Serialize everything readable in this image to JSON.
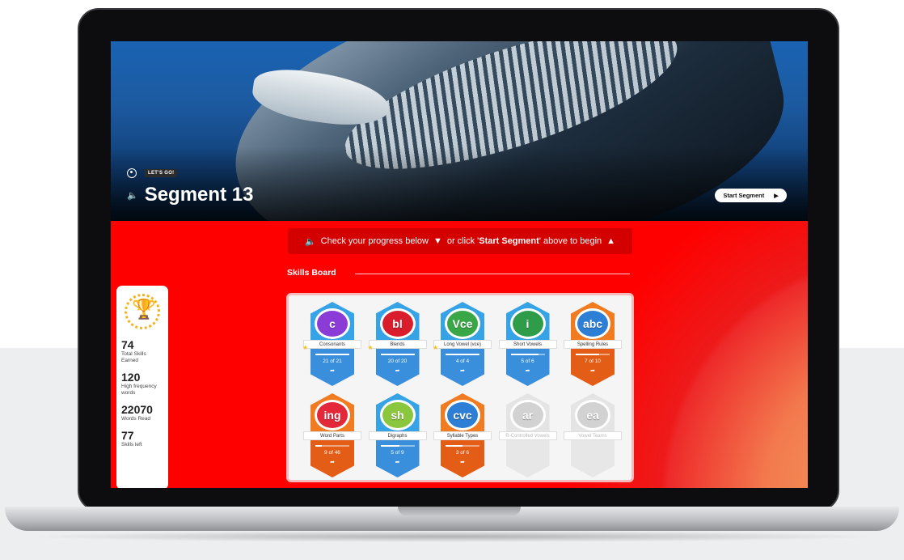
{
  "hero": {
    "tag": "LET'S GO!",
    "title": "Segment 13",
    "start_label": "Start Segment"
  },
  "banner": {
    "text_before": "Check your progress below",
    "text_middle": "or click '",
    "text_bold": "Start Segment",
    "text_after": "' above to begin"
  },
  "skills_board": {
    "heading": "Skills Board",
    "badges": [
      {
        "name": "Consonants",
        "glyph": "c",
        "progress": "21 of 21",
        "fraction": 1.0,
        "color_top": "#35a3e6",
        "color_bottom": "#3a8fdc",
        "coin": "#8b3bd6",
        "starred": true
      },
      {
        "name": "Blends",
        "glyph": "bl",
        "progress": "20 of 20",
        "fraction": 1.0,
        "color_top": "#35a3e6",
        "color_bottom": "#3a8fdc",
        "coin": "#d91d2c",
        "starred": true
      },
      {
        "name": "Long Vowel (vce)",
        "glyph": "Vce",
        "progress": "4 of 4",
        "fraction": 1.0,
        "color_top": "#35a3e6",
        "color_bottom": "#3a8fdc",
        "coin": "#3aa746",
        "starred": true
      },
      {
        "name": "Short Vowels",
        "glyph": "i",
        "progress": "5 of 6",
        "fraction": 0.83,
        "color_top": "#35a3e6",
        "color_bottom": "#3a8fdc",
        "coin": "#2f9c4a",
        "starred": false
      },
      {
        "name": "Spelling Rules",
        "glyph": "abc",
        "progress": "7 of 10",
        "fraction": 0.7,
        "color_top": "#f07b21",
        "color_bottom": "#e35d16",
        "coin": "#2d7fd6",
        "starred": false
      },
      {
        "name": "Word Parts",
        "glyph": "ing",
        "progress": "9 of 46",
        "fraction": 0.2,
        "color_top": "#f07b21",
        "color_bottom": "#e35d16",
        "coin": "#e3283a",
        "starred": false
      },
      {
        "name": "Digraphs",
        "glyph": "sh",
        "progress": "5 of 9",
        "fraction": 0.56,
        "color_top": "#35a3e6",
        "color_bottom": "#3a8fdc",
        "coin": "#8bc63f",
        "starred": false
      },
      {
        "name": "Syllable Types",
        "glyph": "cvc",
        "progress": "3 of 6",
        "fraction": 0.5,
        "color_top": "#f07b21",
        "color_bottom": "#e35d16",
        "coin": "#2d7fd6",
        "starred": false
      },
      {
        "name": "R-Controlled Vowels",
        "glyph": "ar",
        "progress": "",
        "fraction": 0,
        "color_top": "#e4e4e4",
        "color_bottom": "#e7e7e7",
        "coin": "#d2d2d2",
        "starred": false,
        "locked": true
      },
      {
        "name": "Vowel Teams",
        "glyph": "ea",
        "progress": "",
        "fraction": 0,
        "color_top": "#e4e4e4",
        "color_bottom": "#e7e7e7",
        "coin": "#d2d2d2",
        "starred": false,
        "locked": true
      }
    ]
  },
  "stats": [
    {
      "value": "74",
      "label": "Total Skills Earned"
    },
    {
      "value": "120",
      "label": "High frequency words"
    },
    {
      "value": "22070",
      "label": "Words Read"
    },
    {
      "value": "77",
      "label": "Skills left"
    }
  ],
  "icons": {
    "speaker": "speaker-icon",
    "trophy": "trophy-icon",
    "avatar": "avatar-icon",
    "play": "play-icon",
    "share": "share-icon",
    "star": "star-icon"
  }
}
